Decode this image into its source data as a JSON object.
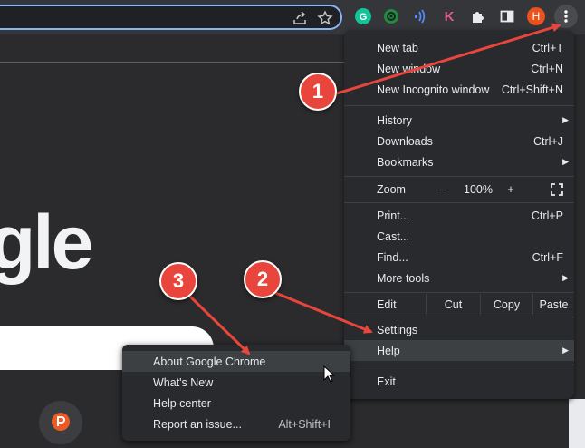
{
  "toolbar": {
    "icons": [
      "share-icon",
      "bookmark-star-icon",
      "grammarly-icon",
      "green-extension-icon",
      "audio-extension-icon",
      "k-extension-icon",
      "puzzle-extensions-icon",
      "side-panel-icon",
      "profile-avatar",
      "kebab-menu-icon"
    ],
    "k_letter": "K",
    "avatar_letter": "H"
  },
  "page": {
    "logo_fragment": "gle"
  },
  "menu": {
    "new_tab": {
      "label": "New tab",
      "shortcut": "Ctrl+T"
    },
    "new_window": {
      "label": "New window",
      "shortcut": "Ctrl+N"
    },
    "new_incognito": {
      "label": "New Incognito window",
      "shortcut": "Ctrl+Shift+N"
    },
    "history": {
      "label": "History"
    },
    "downloads": {
      "label": "Downloads",
      "shortcut": "Ctrl+J"
    },
    "bookmarks": {
      "label": "Bookmarks"
    },
    "zoom": {
      "label": "Zoom",
      "minus": "–",
      "value": "100%",
      "plus": "+"
    },
    "print": {
      "label": "Print...",
      "shortcut": "Ctrl+P"
    },
    "cast": {
      "label": "Cast..."
    },
    "find": {
      "label": "Find...",
      "shortcut": "Ctrl+F"
    },
    "more_tools": {
      "label": "More tools"
    },
    "edit": {
      "label": "Edit",
      "cut": "Cut",
      "copy": "Copy",
      "paste": "Paste"
    },
    "settings": {
      "label": "Settings"
    },
    "help": {
      "label": "Help"
    },
    "exit": {
      "label": "Exit"
    }
  },
  "help_submenu": {
    "about": {
      "label": "About Google Chrome"
    },
    "whats_new": {
      "label": "What's New"
    },
    "help_center": {
      "label": "Help center"
    },
    "report_issue": {
      "label": "Report an issue...",
      "shortcut": "Alt+Shift+I"
    }
  },
  "annotations": {
    "step1": "1",
    "step2": "2",
    "step3": "3"
  },
  "colors": {
    "accent": "#8ab4f8",
    "annotation_red": "#e8453c",
    "avatar": "#e8531f",
    "menu_bg": "#292a2d"
  }
}
